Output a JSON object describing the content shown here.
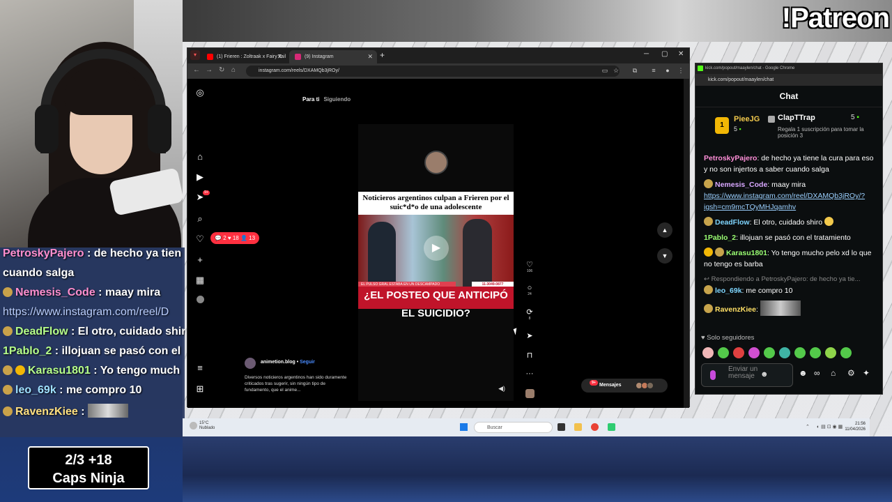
{
  "overlay": {
    "patreon": "!Patreon",
    "ninja_line1": "2/3  +18",
    "ninja_line2": "Caps Ninja",
    "chat": [
      {
        "user": "PetroskyPajero",
        "text": " : de hecho ya tien"
      },
      {
        "user": "",
        "text": "cuando salga"
      },
      {
        "user": "Nemesis_Code",
        "text": " : maay mira"
      },
      {
        "user": "",
        "link": "https://www.instagram.com/reel/D"
      },
      {
        "user": "DeadFlow",
        "text": " : El otro, cuidado shir"
      },
      {
        "user": "1Pablo_2",
        "text": " : illojuan se pasó con el"
      },
      {
        "user": "Karasu1801",
        "text": " : Yo tengo much"
      },
      {
        "user": "leo_69k",
        "text": " : me compro 10"
      },
      {
        "user": "RavenzKiee",
        "text": " : "
      }
    ]
  },
  "browser": {
    "tab1": "(1) Frieren : Zoltraak x Fairy Tail",
    "tab2": "(9) Instagram",
    "url": "instagram.com/reels/DXAMQb3jROy/"
  },
  "instagram": {
    "tab_active": "Para ti",
    "tab_inactive": "Siguiendo",
    "notif_comments": "2",
    "notif_likes": "18",
    "notif_follows": "13",
    "nav_badge": "9+",
    "headline": "Noticieros argentinos culpan a Frieren por el suic*d*o de una adolescente",
    "banner": "¿EL POSTEO QUE ANTICIPÓ EL SUICIDIO?",
    "chip_left": "EL PULSO GRAL  ESTABA EN UN DESCAMPADO",
    "chip_right": "11-3049-0877",
    "author": "animetion.blog",
    "follow": "Seguir",
    "description": "Diversos noticieros argentinos han sido duramente criticados tras sugerir, sin ningún tipo de fundamento, que el anime...",
    "likes": "106",
    "comments": "24",
    "reposts": "8",
    "messages_label": "Mensajes",
    "messages_badge": "9+"
  },
  "taskbar": {
    "temp": "15°C",
    "weather": "Nublado",
    "search": "Buscar",
    "time": "21:56",
    "date": "11/04/2026"
  },
  "kick": {
    "window_title": "kick.com/popout/maaylen/chat - Google Chrome",
    "url": "kick.com/popout/maaylen/chat",
    "heading": "Chat",
    "gifter1": "PieeJG",
    "gifter1_count": "5",
    "gifter1_rank": "1",
    "gifter2": "ClapTTrap",
    "gifter2_count": "5",
    "gifter2_sub": "Regala 1 suscripción para tomar la posición 3",
    "messages": [
      {
        "user": "PetroskyPajero",
        "color": "#ff8fd8",
        "text": ": de hecho ya tiene la cura para eso y no son injertos a saber cuando salga"
      },
      {
        "user": "Nemesis_Code",
        "color": "#d9a8ff",
        "text": ": maay mira",
        "link": "https://www.instagram.com/reel/DXAMQb3jROy/?igsh=cm9mcTQyMHJqamhv"
      },
      {
        "user": "DeadFlow",
        "color": "#7fd6ff",
        "text": ": El otro, cuidado shiro"
      },
      {
        "user": "1Pablo_2",
        "color": "#9bff73",
        "text": ": illojuan se pasó con el tratamiento"
      },
      {
        "user": "Karasu1801",
        "color": "#9bff73",
        "text": ": Yo tengo mucho pelo xd lo que no tengo es barba"
      },
      {
        "reply": "Respondiendo a PetroskyPajero: de hecho ya tie..."
      },
      {
        "user": "leo_69k",
        "color": "#7fd6ff",
        "text": ": me compro 10"
      },
      {
        "user": "RavenzKiee",
        "color": "#ffe066",
        "text": ":"
      }
    ],
    "followers_only": "Solo seguidores",
    "input_placeholder": "Enviar un mensaje"
  }
}
